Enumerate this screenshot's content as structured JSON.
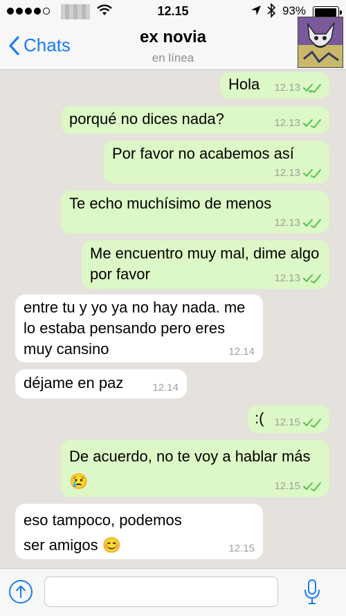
{
  "status_bar": {
    "time": "12.15",
    "battery_percent": "93%",
    "signal_bars": 5,
    "signal_filled": 4,
    "icons": [
      "signal-dots-icon",
      "wifi-icon",
      "location-arrow-icon",
      "bluetooth-icon",
      "battery-icon"
    ]
  },
  "header": {
    "back_label": "Chats",
    "contact_name": "ex novia",
    "contact_status": "en línea"
  },
  "messages": [
    {
      "direction": "out",
      "text": "Hola",
      "time": "12.13",
      "read": true
    },
    {
      "direction": "out",
      "text": "porqué no dices nada?",
      "time": "12.13",
      "read": true
    },
    {
      "direction": "out",
      "text": "Por favor no acabemos así",
      "time": "12.13",
      "read": true
    },
    {
      "direction": "out",
      "text": "Te echo muchísimo de menos",
      "time": "12.13",
      "read": true
    },
    {
      "direction": "out",
      "text": "Me encuentro muy mal, dime algo por favor",
      "time": "12.13",
      "read": true
    },
    {
      "direction": "in",
      "text": "entre tu y yo ya no hay nada. me lo estaba pensando pero eres muy cansino",
      "time": "12.14"
    },
    {
      "direction": "in",
      "text": "déjame en paz",
      "time": "12.14"
    },
    {
      "direction": "out",
      "text": ":(",
      "time": "12.15",
      "read": true
    },
    {
      "direction": "out",
      "text": "De acuerdo, no te voy a hablar más 😢",
      "time": "12.15",
      "read": true
    },
    {
      "direction": "in",
      "text": "eso tampoco, podemos ser amigos 😊",
      "time": "12.15"
    }
  ],
  "colors": {
    "outgoing_bubble": "#dcf8c6",
    "incoming_bubble": "#ffffff",
    "accent": "#1a7cf5",
    "read_ticks": "#4fc14a",
    "background": "#e5e1dc"
  },
  "input": {
    "value": "",
    "placeholder": ""
  }
}
